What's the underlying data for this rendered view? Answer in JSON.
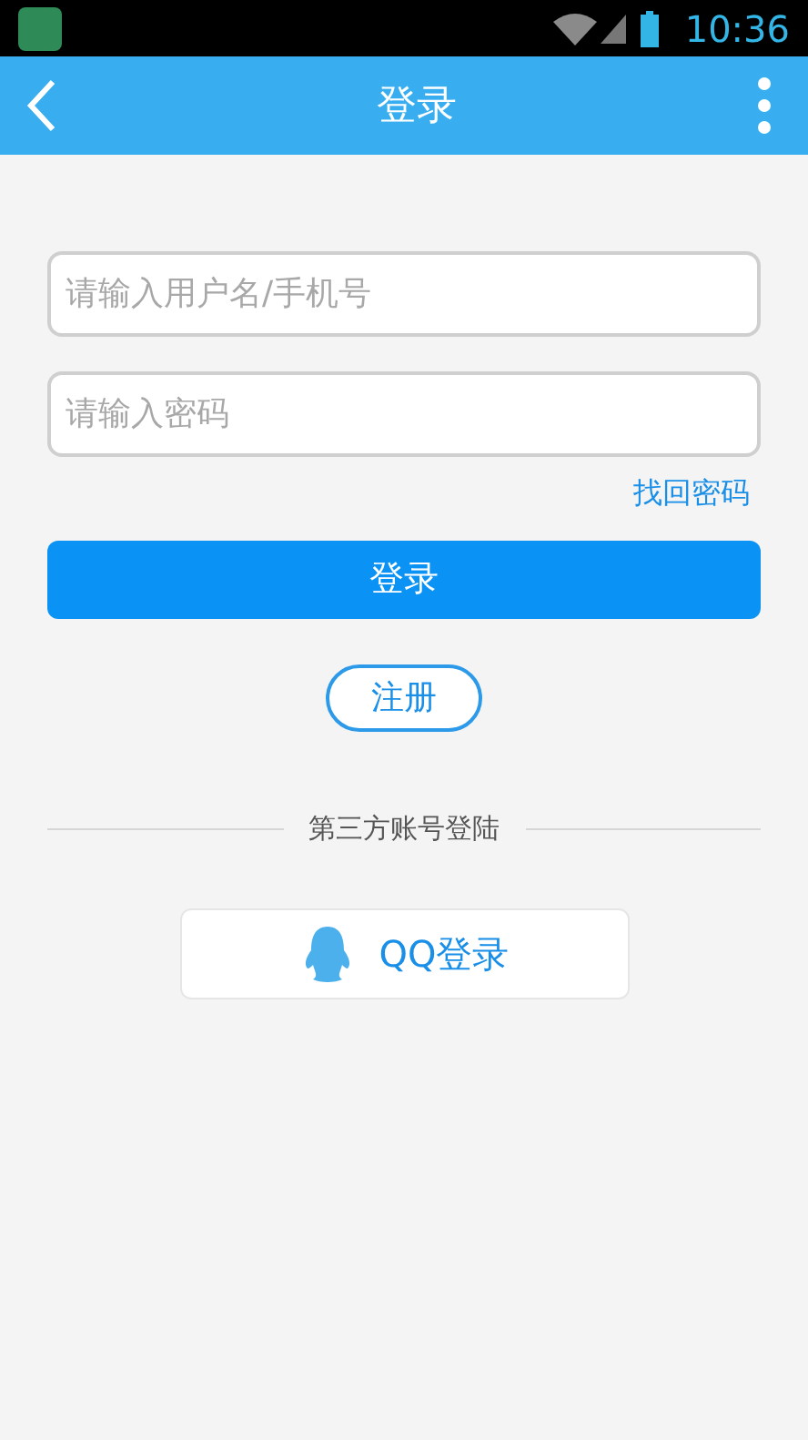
{
  "status_bar": {
    "time": "10:36"
  },
  "header": {
    "title": "登录"
  },
  "form": {
    "username": {
      "placeholder": "请输入用户名/手机号"
    },
    "password": {
      "placeholder": "请输入密码"
    },
    "forgot_link": "找回密码",
    "login_button": "登录",
    "register_button": "注册"
  },
  "third_party": {
    "heading": "第三方账号登陆",
    "qq_button": "QQ登录"
  }
}
